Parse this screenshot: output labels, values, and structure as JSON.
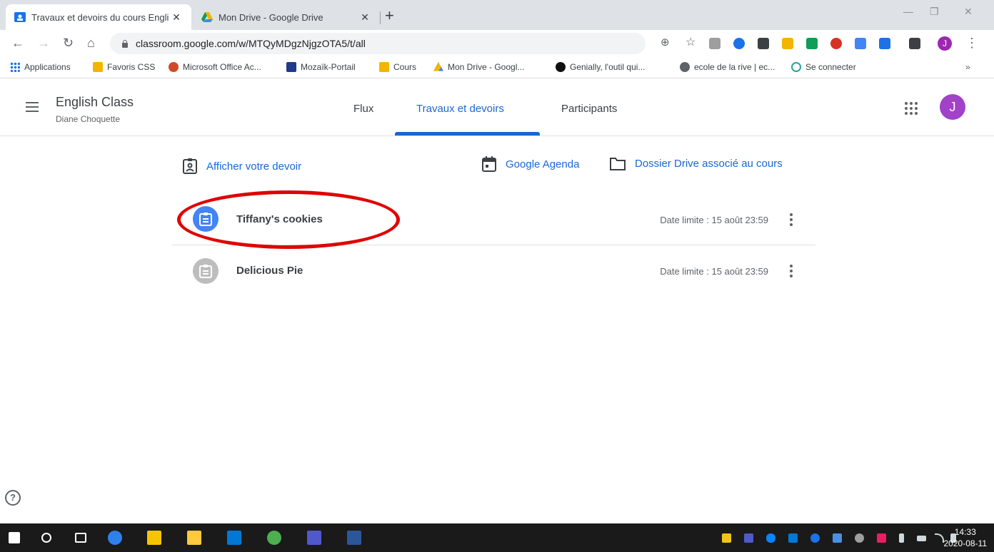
{
  "browser": {
    "tabs": [
      {
        "label": "Travaux et devoirs du cours Engli",
        "active": true
      },
      {
        "label": "Mon Drive - Google Drive",
        "active": false
      }
    ],
    "new_tab_symbol": "+",
    "url": "classroom.google.com/w/MTQyMDgzNjgzOTA5/t/all",
    "profile_initial": "J",
    "bookmarks": [
      {
        "label": "Applications",
        "icon": "apps-grid-icon",
        "color": "#1a73e8"
      },
      {
        "label": "Favoris CSS",
        "icon": "folder-icon",
        "color": "#f4b400"
      },
      {
        "label": "Microsoft Office Ac...",
        "icon": "powerpoint-icon",
        "color": "#d24726"
      },
      {
        "label": "Mozaïk-Portail",
        "icon": "mozaik-icon",
        "color": "#1e3a8a"
      },
      {
        "label": "Cours",
        "icon": "classroom-icon",
        "color": "#f4b400"
      },
      {
        "label": "Mon Drive - Googl...",
        "icon": "drive-icon",
        "color": "#0f9d58"
      },
      {
        "label": "Genially, l'outil qui...",
        "icon": "genially-icon",
        "color": "#111111"
      },
      {
        "label": "ecole de la rive | ec...",
        "icon": "globe-icon",
        "color": "#5f6368"
      },
      {
        "label": "Se connecter",
        "icon": "link-icon",
        "color": "#26a69a"
      }
    ],
    "bookmarks_overflow": "»"
  },
  "classroom": {
    "class_name": "English Class",
    "teacher": "Diane Choquette",
    "nav_tabs": [
      {
        "label": "Flux"
      },
      {
        "label": "Travaux et devoirs",
        "active": true
      },
      {
        "label": "Participants"
      }
    ],
    "user_initial": "J",
    "accent_color": "#1967d2",
    "actions": {
      "view_work": "Afficher votre devoir",
      "calendar": "Google Agenda",
      "drive_folder": "Dossier Drive associé au cours"
    },
    "assignments": [
      {
        "title": "Tiffany's cookies",
        "due": "Date limite : 15 août 23:59",
        "icon_color": "#4285f4",
        "annotated": true
      },
      {
        "title": "Delicious Pie",
        "due": "Date limite : 15 août 23:59",
        "icon_color": "#bdbdbd",
        "annotated": false
      }
    ],
    "help_symbol": "?"
  },
  "taskbar": {
    "time": "14:33",
    "date": "2020-08-11"
  }
}
